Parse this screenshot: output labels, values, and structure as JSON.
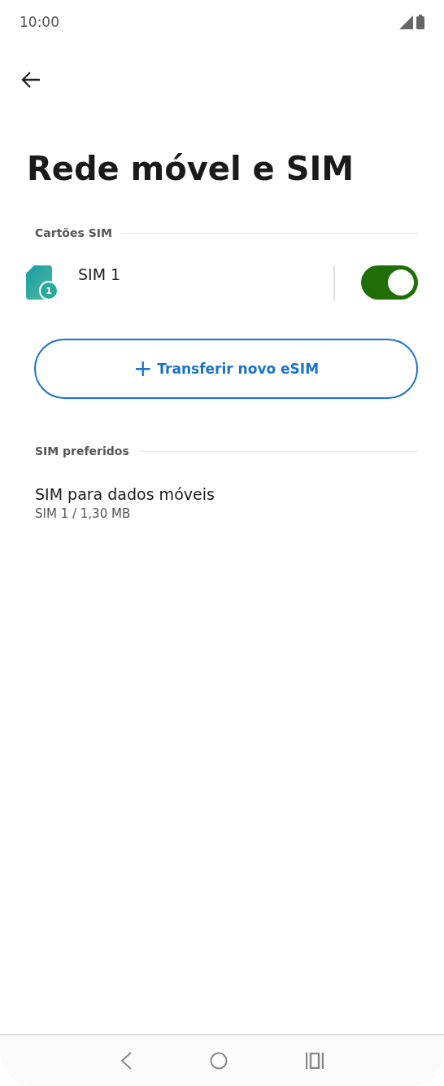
{
  "status_bar": {
    "time": "10:00"
  },
  "title": "Rede móvel e SIM",
  "sections": [
    {
      "header": "Cartões SIM",
      "kind": "sims",
      "sims": [
        {
          "name": "SIM 1",
          "badge": "1",
          "on": true
        }
      ],
      "button": {
        "plus": "+",
        "label": "Transferir novo eSIM"
      }
    },
    {
      "header": "SIM preferidos",
      "kind": "prefs",
      "items": [
        {
          "title": "SIM para dados móveis",
          "subtitle": "SIM 1 / 1,30 MB"
        }
      ]
    }
  ]
}
